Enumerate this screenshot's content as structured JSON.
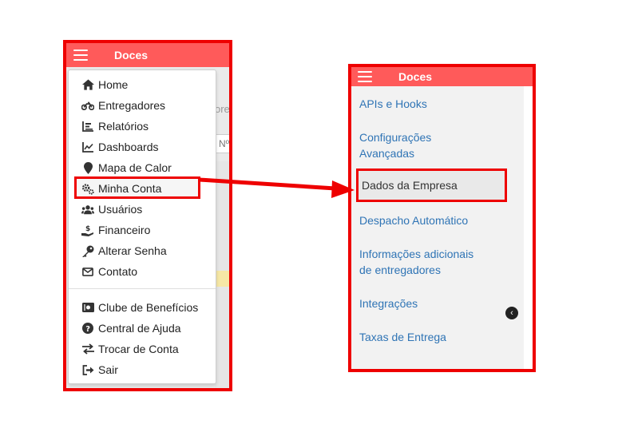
{
  "left_panel": {
    "brand": "Doces",
    "background_hint_text": "ores",
    "background_box_text": "Nº",
    "menu": {
      "items": [
        {
          "label": "Home",
          "icon": "home-icon"
        },
        {
          "label": "Entregadores",
          "icon": "motorcycle-icon"
        },
        {
          "label": "Relatórios",
          "icon": "report-list-icon"
        },
        {
          "label": "Dashboards",
          "icon": "line-chart-icon"
        },
        {
          "label": "Mapa de Calor",
          "icon": "map-pin-icon"
        },
        {
          "label": "Minha Conta",
          "icon": "gears-icon"
        },
        {
          "label": "Usuários",
          "icon": "users-icon"
        },
        {
          "label": "Financeiro",
          "icon": "hand-dollar-icon"
        },
        {
          "label": "Alterar Senha",
          "icon": "key-icon"
        },
        {
          "label": "Contato",
          "icon": "envelope-icon"
        }
      ],
      "secondary_items": [
        {
          "label": "Clube de Benefícios",
          "icon": "ticket-icon"
        },
        {
          "label": "Central de Ajuda",
          "icon": "question-circle-icon"
        },
        {
          "label": "Trocar de Conta",
          "icon": "swap-arrows-icon"
        },
        {
          "label": "Sair",
          "icon": "sign-out-icon"
        }
      ]
    }
  },
  "right_panel": {
    "brand": "Doces",
    "links": [
      {
        "label": "APIs e Hooks"
      },
      {
        "label_line1": "Configurações",
        "label_line2": "Avançadas"
      },
      {
        "label": "Dados da Empresa",
        "active": true
      },
      {
        "label": "Despacho Automático"
      },
      {
        "label_line1": "Informações adicionais",
        "label_line2": "de entregadores"
      },
      {
        "label": "Integrações"
      },
      {
        "label": "Taxas de Entrega"
      }
    ],
    "collapse_icon": "chevron-left-icon"
  },
  "colors": {
    "header": "#ff5a5a",
    "annotation": "#ee0000",
    "link": "#2f74b5"
  }
}
